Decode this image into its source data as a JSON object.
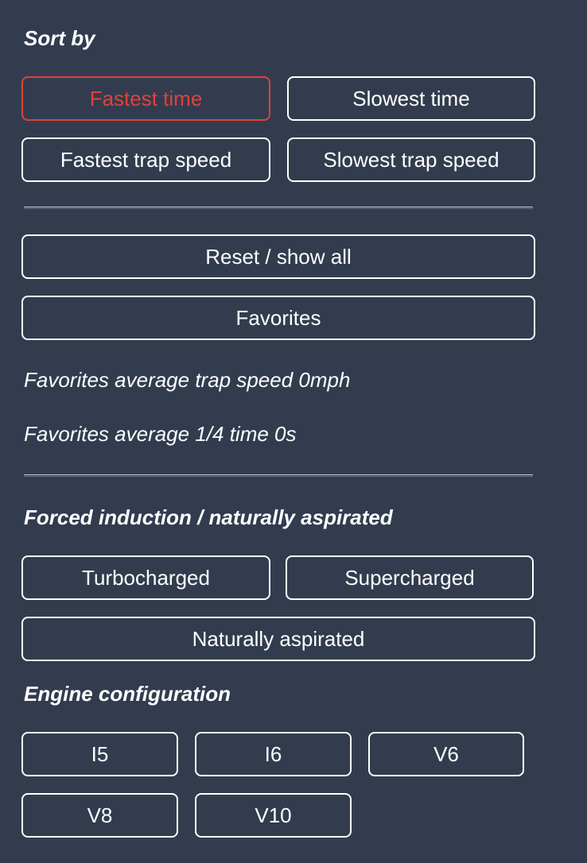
{
  "sort": {
    "heading": "Sort by",
    "options": [
      {
        "label": "Fastest time",
        "active": true
      },
      {
        "label": "Slowest time",
        "active": false
      },
      {
        "label": "Fastest trap speed",
        "active": false
      },
      {
        "label": "Slowest trap speed",
        "active": false
      }
    ]
  },
  "actions": {
    "reset_label": "Reset / show all",
    "favorites_label": "Favorites"
  },
  "stats": {
    "avg_trap_speed": "Favorites average trap speed 0mph",
    "avg_quarter_time": "Favorites average 1/4 time 0s"
  },
  "induction": {
    "heading": "Forced induction / naturally aspirated",
    "options": [
      "Turbocharged",
      "Supercharged",
      "Naturally aspirated"
    ]
  },
  "engine": {
    "heading": "Engine configuration",
    "options": [
      "I5",
      "I6",
      "V6",
      "V8",
      "V10"
    ]
  },
  "colors": {
    "background": "#323c4e",
    "active": "#e0413a",
    "text": "#ffffff"
  }
}
